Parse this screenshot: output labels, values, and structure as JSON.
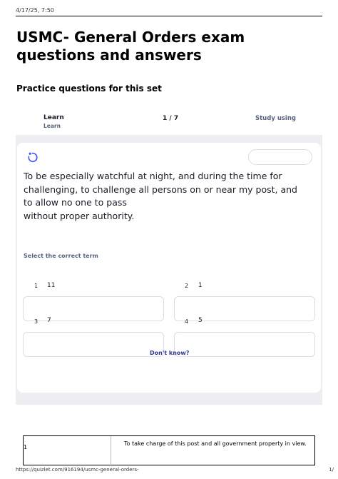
{
  "print": {
    "datetime": "4/17/25, 7:50",
    "url": "https://quizlet.com/916194/usmc-general-orders-",
    "page": "1/"
  },
  "page_title": "USMC- General Orders exam questions and answers",
  "subtitle": "Practice questions for this set",
  "learn_bar": {
    "mode": "Learn",
    "mode_sub": "Learn",
    "progress": "1 / 7",
    "study_using": "Study using"
  },
  "question": {
    "prompt_lines": [
      "To be especially watchful at night, and during the time for",
      "challenging, to challenge all persons on or near my post, and",
      "to allow no one to pass",
      "without proper authority."
    ],
    "instruction": "Select the correct term",
    "options": [
      {
        "num": "1",
        "text": "11"
      },
      {
        "num": "2",
        "text": "1"
      },
      {
        "num": "3",
        "text": "7"
      },
      {
        "num": "4",
        "text": "5"
      }
    ],
    "dont_know": "Don't know?"
  },
  "table": {
    "rows": [
      {
        "term": "1",
        "definition": "To take charge of this post and all government property in view."
      }
    ]
  },
  "colors": {
    "stage_bg": "#eceef2",
    "muted_text": "#586380",
    "link": "#2f3a8f",
    "icon_blue": "#4255ff"
  }
}
